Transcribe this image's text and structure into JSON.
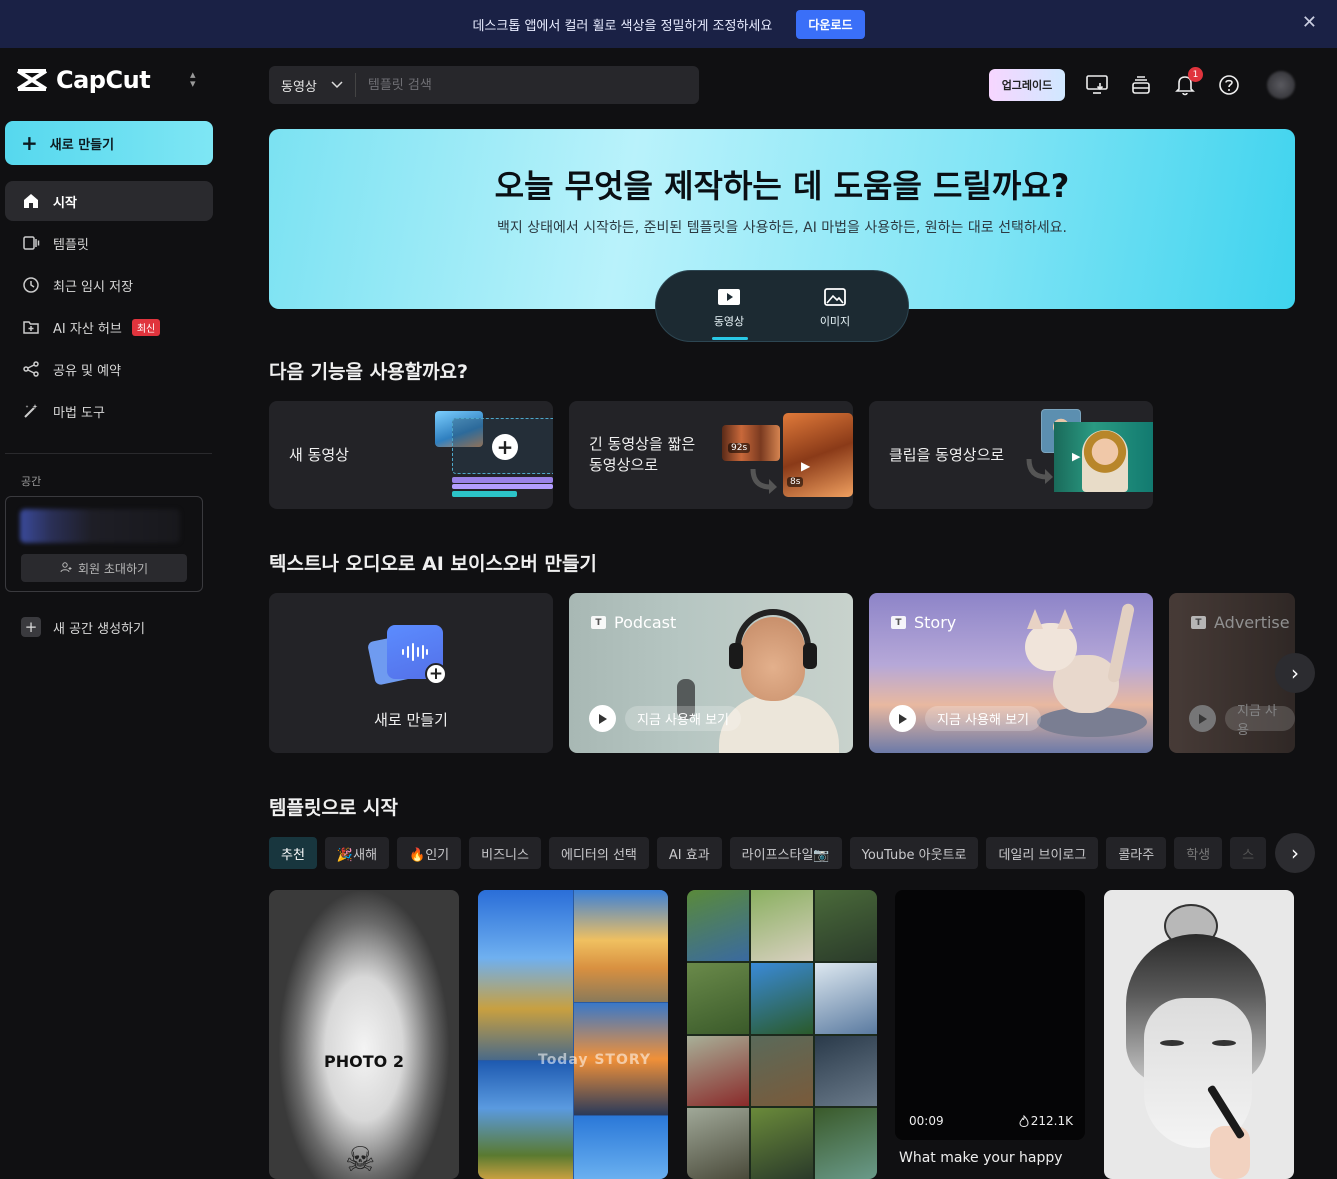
{
  "banner": {
    "text": "데스크톱 앱에서 컬러 휠로 색상을 정밀하게 조정하세요",
    "button": "다운로드"
  },
  "app": {
    "logo_text": "CapCut"
  },
  "sidebar": {
    "new_button": "새로 만들기",
    "items": [
      {
        "label": "시작",
        "icon": "home-icon",
        "active": true
      },
      {
        "label": "템플릿",
        "icon": "template-icon"
      },
      {
        "label": "최근 임시 저장",
        "icon": "clock-icon"
      },
      {
        "label": "AI 자산 허브",
        "icon": "asset-hub-icon",
        "badge": "최신"
      },
      {
        "label": "공유 및 예약",
        "icon": "share-icon"
      },
      {
        "label": "마법 도구",
        "icon": "magic-wand-icon"
      }
    ],
    "space_label": "공간",
    "invite_button": "회원 초대하기",
    "new_space": "새 공간 생성하기"
  },
  "header": {
    "search_type": "동영상",
    "search_placeholder": "템플릿 검색",
    "upgrade": "업그레이드",
    "notification_count": "1"
  },
  "hero": {
    "title": "오늘 무엇을 제작하는 데 도움을 드릴까요?",
    "subtitle": "백지 상태에서 시작하든, 준비된 템플릿을 사용하든, AI 마법을 사용하든, 원하는 대로 선택하세요.",
    "modes": [
      {
        "label": "동영상",
        "active": true
      },
      {
        "label": "이미지"
      }
    ]
  },
  "features": {
    "title": "다음 기능을 사용할까요?",
    "cards": [
      {
        "label": "새 동영상"
      },
      {
        "label": "긴 동영상을 짧은\n동영상으로",
        "badge_a": "92s",
        "badge_b": "8s"
      },
      {
        "label": "클립을 동영상으로"
      }
    ]
  },
  "voiceover": {
    "title": "텍스트나 오디오로 AI 보이스오버 만들기",
    "new_label": "새로 만들기",
    "cards": [
      {
        "tag": "Podcast",
        "cta": "지금 사용해 보기"
      },
      {
        "tag": "Story",
        "cta": "지금 사용해 보기"
      },
      {
        "tag": "Advertise",
        "cta": "지금 사용"
      }
    ]
  },
  "templates": {
    "title": "템플릿으로 시작",
    "chips": [
      "추천",
      "🎉새해",
      "🔥인기",
      "비즈니스",
      "에디터의 선택",
      "AI 효과",
      "라이프스타일📷",
      "YouTube 아웃트로",
      "데일리 브이로그",
      "콜라주",
      "학생",
      "스"
    ],
    "cards": [
      {
        "overlay_text": "PHOTO 2"
      },
      {
        "overlay_text": "Today STORY"
      },
      {
        "overlay_text": ""
      },
      {
        "duration": "00:09",
        "uses": "212.1K",
        "caption": "What make your happy"
      },
      {
        "overlay_text": ""
      }
    ]
  },
  "colors": {
    "accent": "#29c8e6",
    "banner_bg": "#1a2145",
    "download_btn": "#3a6ff8",
    "badge_red": "#e0343d"
  }
}
